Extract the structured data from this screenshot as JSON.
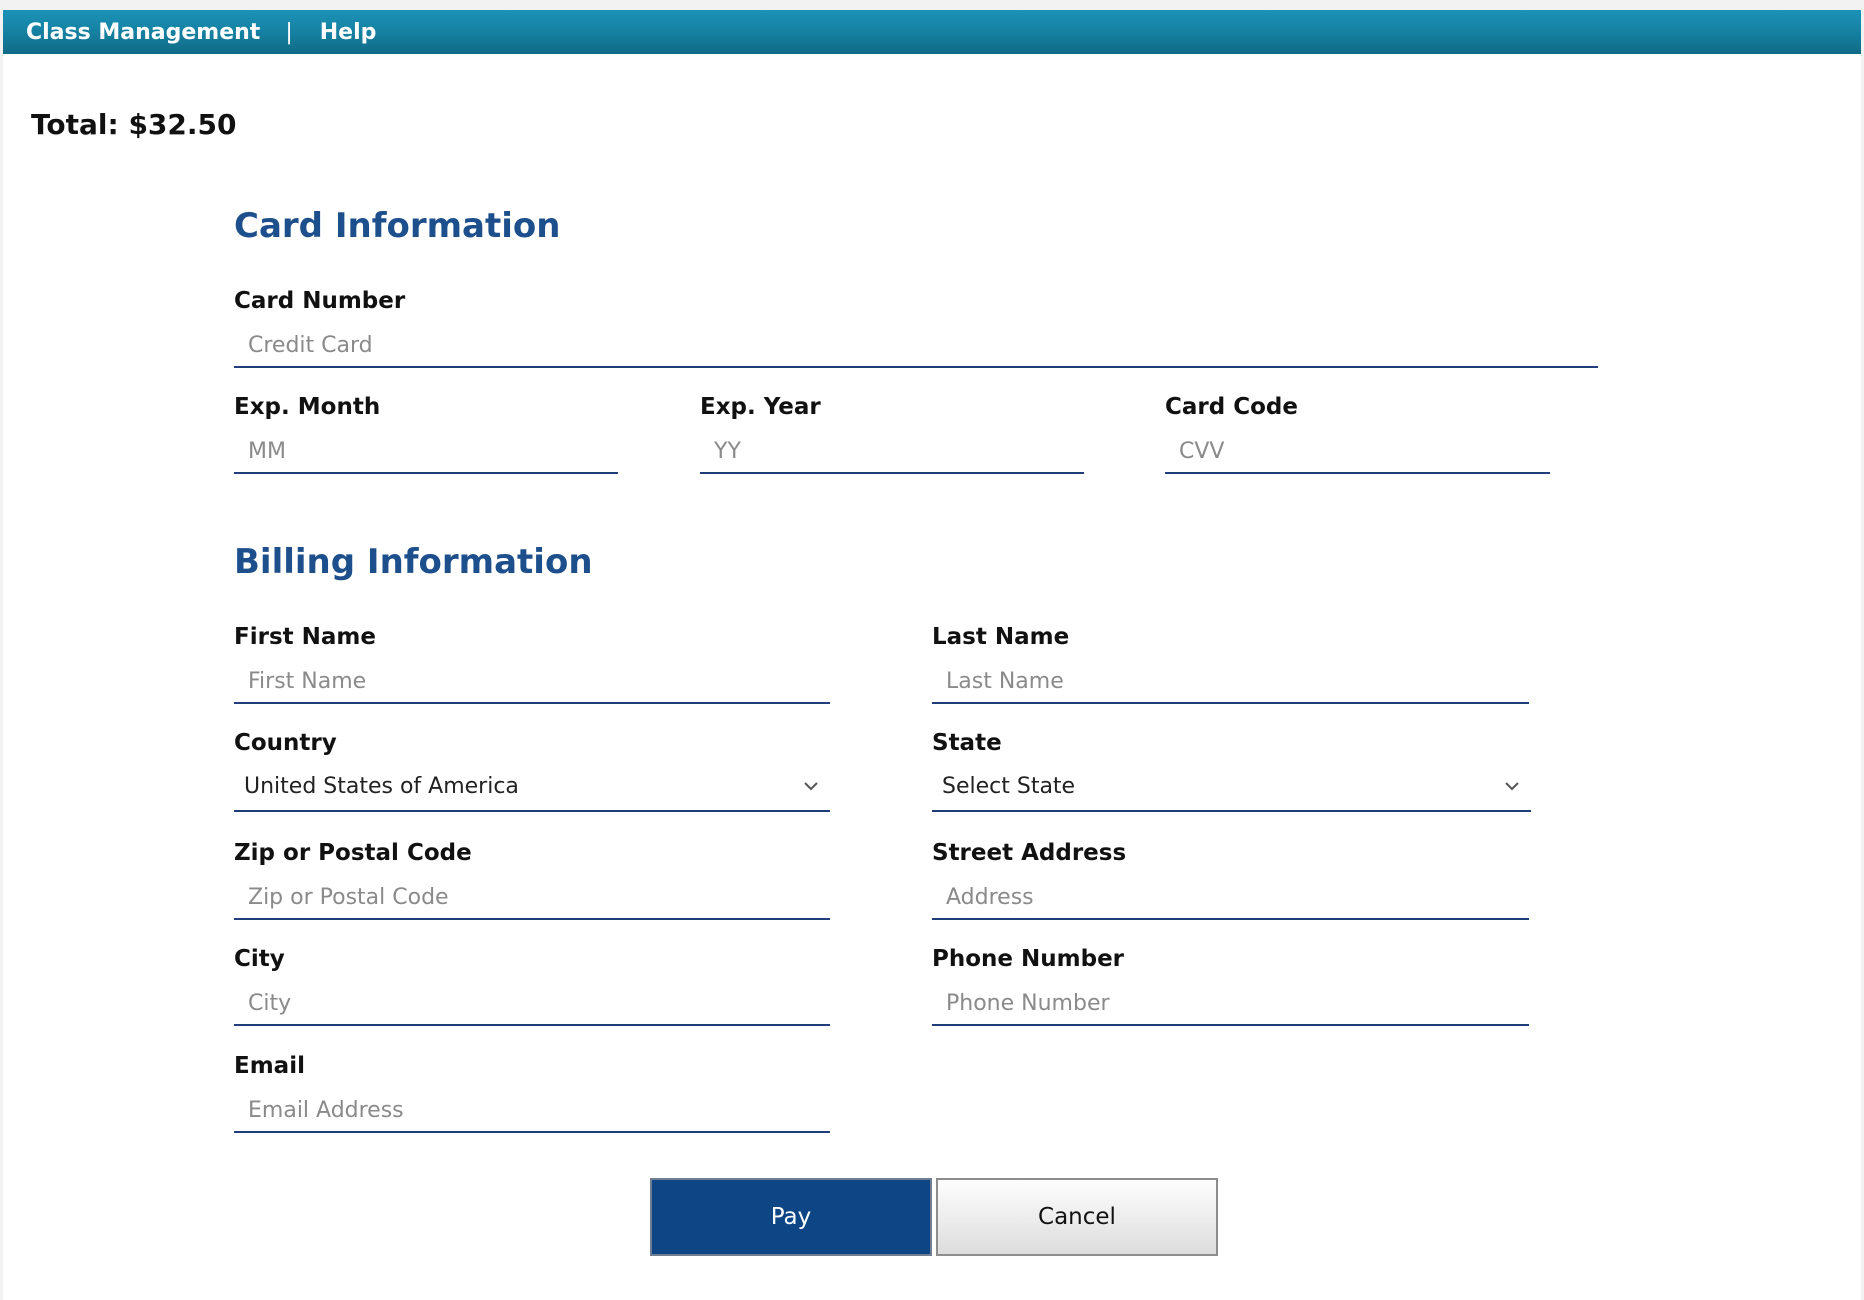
{
  "nav": {
    "class_management": "Class Management",
    "separator": "|",
    "help": "Help"
  },
  "order": {
    "total": "Total: $32.50"
  },
  "card_section": {
    "title": "Card Information",
    "card_number": {
      "label": "Card Number",
      "placeholder": "Credit Card",
      "value": ""
    },
    "exp_month": {
      "label": "Exp. Month",
      "placeholder": "MM",
      "value": ""
    },
    "exp_year": {
      "label": "Exp. Year",
      "placeholder": "YY",
      "value": ""
    },
    "card_code": {
      "label": "Card Code",
      "placeholder": "CVV",
      "value": ""
    }
  },
  "billing_section": {
    "title": "Billing Information",
    "first_name": {
      "label": "First Name",
      "placeholder": "First Name",
      "value": ""
    },
    "last_name": {
      "label": "Last Name",
      "placeholder": "Last Name",
      "value": ""
    },
    "country": {
      "label": "Country",
      "selected": "United States of America"
    },
    "state": {
      "label": "State",
      "selected": "Select State"
    },
    "zip": {
      "label": "Zip or Postal Code",
      "placeholder": "Zip or Postal Code",
      "value": ""
    },
    "street": {
      "label": "Street Address",
      "placeholder": "Address",
      "value": ""
    },
    "city": {
      "label": "City",
      "placeholder": "City",
      "value": ""
    },
    "phone": {
      "label": "Phone Number",
      "placeholder": "Phone Number",
      "value": ""
    },
    "email": {
      "label": "Email",
      "placeholder": "Email Address",
      "value": ""
    }
  },
  "actions": {
    "pay_label": "Pay",
    "cancel_label": "Cancel"
  },
  "colors": {
    "topbar": "#157f9f",
    "section_title": "#1c4f8c",
    "field_underline": "#1e3d7a",
    "pay_button": "#0d4585",
    "cancel_button": "#ececec"
  },
  "icons": {
    "select_arrow": "chevron-down-icon"
  }
}
